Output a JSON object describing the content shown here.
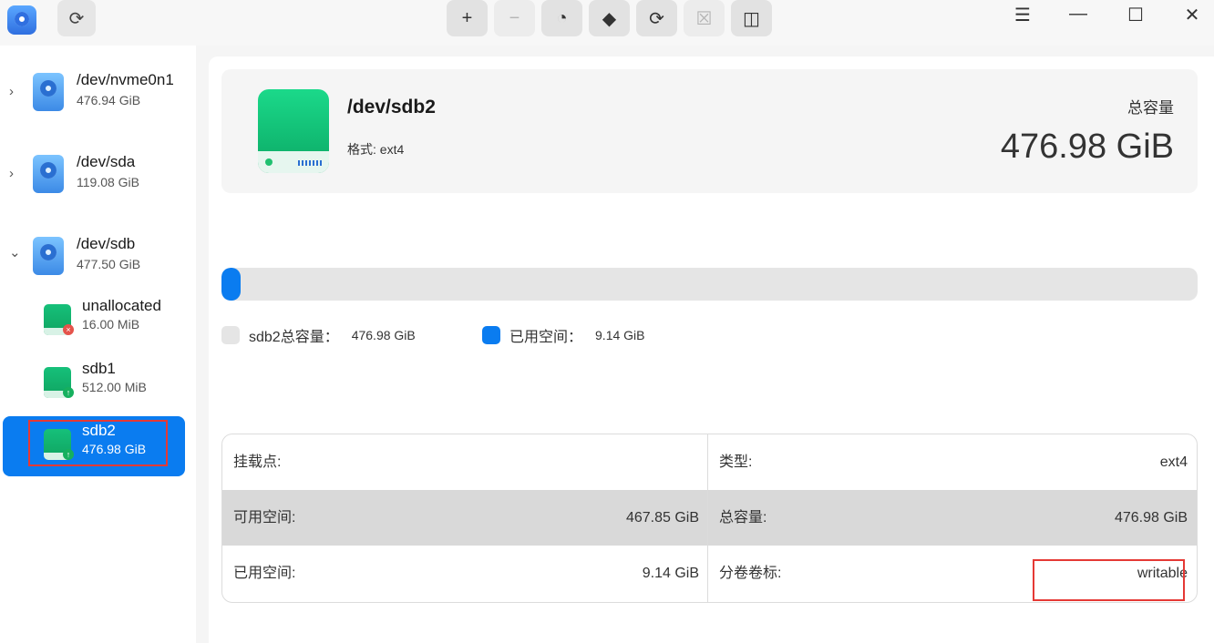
{
  "toolbar": {
    "buttons": [
      {
        "name": "create-partition-button",
        "glyph": "+",
        "disabled": false
      },
      {
        "name": "delete-partition-button",
        "glyph": "−",
        "disabled": true
      },
      {
        "name": "space-allocation-button",
        "glyph": "◔",
        "disabled": false
      },
      {
        "name": "wipe-button",
        "glyph": "◆",
        "disabled": false
      },
      {
        "name": "mount-button",
        "glyph": "⟳",
        "disabled": false
      },
      {
        "name": "unmount-button",
        "glyph": "☒",
        "disabled": true
      },
      {
        "name": "resize-button",
        "glyph": "◫",
        "disabled": false
      }
    ]
  },
  "window": {
    "menu": "☰",
    "minimize": "—",
    "maximize": "☐",
    "close": "✕"
  },
  "sidebar": {
    "disks": [
      {
        "chevron": "›",
        "name": "/dev/nvme0n1",
        "size": "476.94 GiB"
      },
      {
        "chevron": "›",
        "name": "/dev/sda",
        "size": "119.08 GiB"
      },
      {
        "chevron": "⌄",
        "name": "/dev/sdb",
        "size": "477.50 GiB"
      }
    ],
    "partitions": [
      {
        "name": "unallocated",
        "size": "16.00 MiB",
        "badge": "×",
        "badge_color": "#e5534b"
      },
      {
        "name": "sdb1",
        "size": "512.00 MiB",
        "badge": "↑",
        "badge_color": "#16b05e"
      },
      {
        "name": "sdb2",
        "size": "476.98 GiB",
        "badge": "↑",
        "badge_color": "#16b05e"
      }
    ]
  },
  "info": {
    "name": "/dev/sdb2",
    "format": "格式: ext4",
    "capacity_label": "总容量",
    "capacity": "476.98 GiB"
  },
  "usage": {
    "used_fraction": 0.0192,
    "total_label": "sdb2总容量：",
    "total_value": "476.98 GiB",
    "used_label": "已用空间：",
    "used_value": "9.14 GiB",
    "colors": {
      "total": "#e5e5e5",
      "used": "#0a7cf0"
    }
  },
  "details": [
    {
      "left_label": "挂载点:",
      "left_value": "",
      "right_label": "类型:",
      "right_value": "ext4"
    },
    {
      "left_label": "可用空间:",
      "left_value": "467.85 GiB",
      "right_label": "总容量:",
      "right_value": "476.98 GiB"
    },
    {
      "left_label": "已用空间:",
      "left_value": "9.14 GiB",
      "right_label": "分卷卷标:",
      "right_value": "writable"
    }
  ]
}
